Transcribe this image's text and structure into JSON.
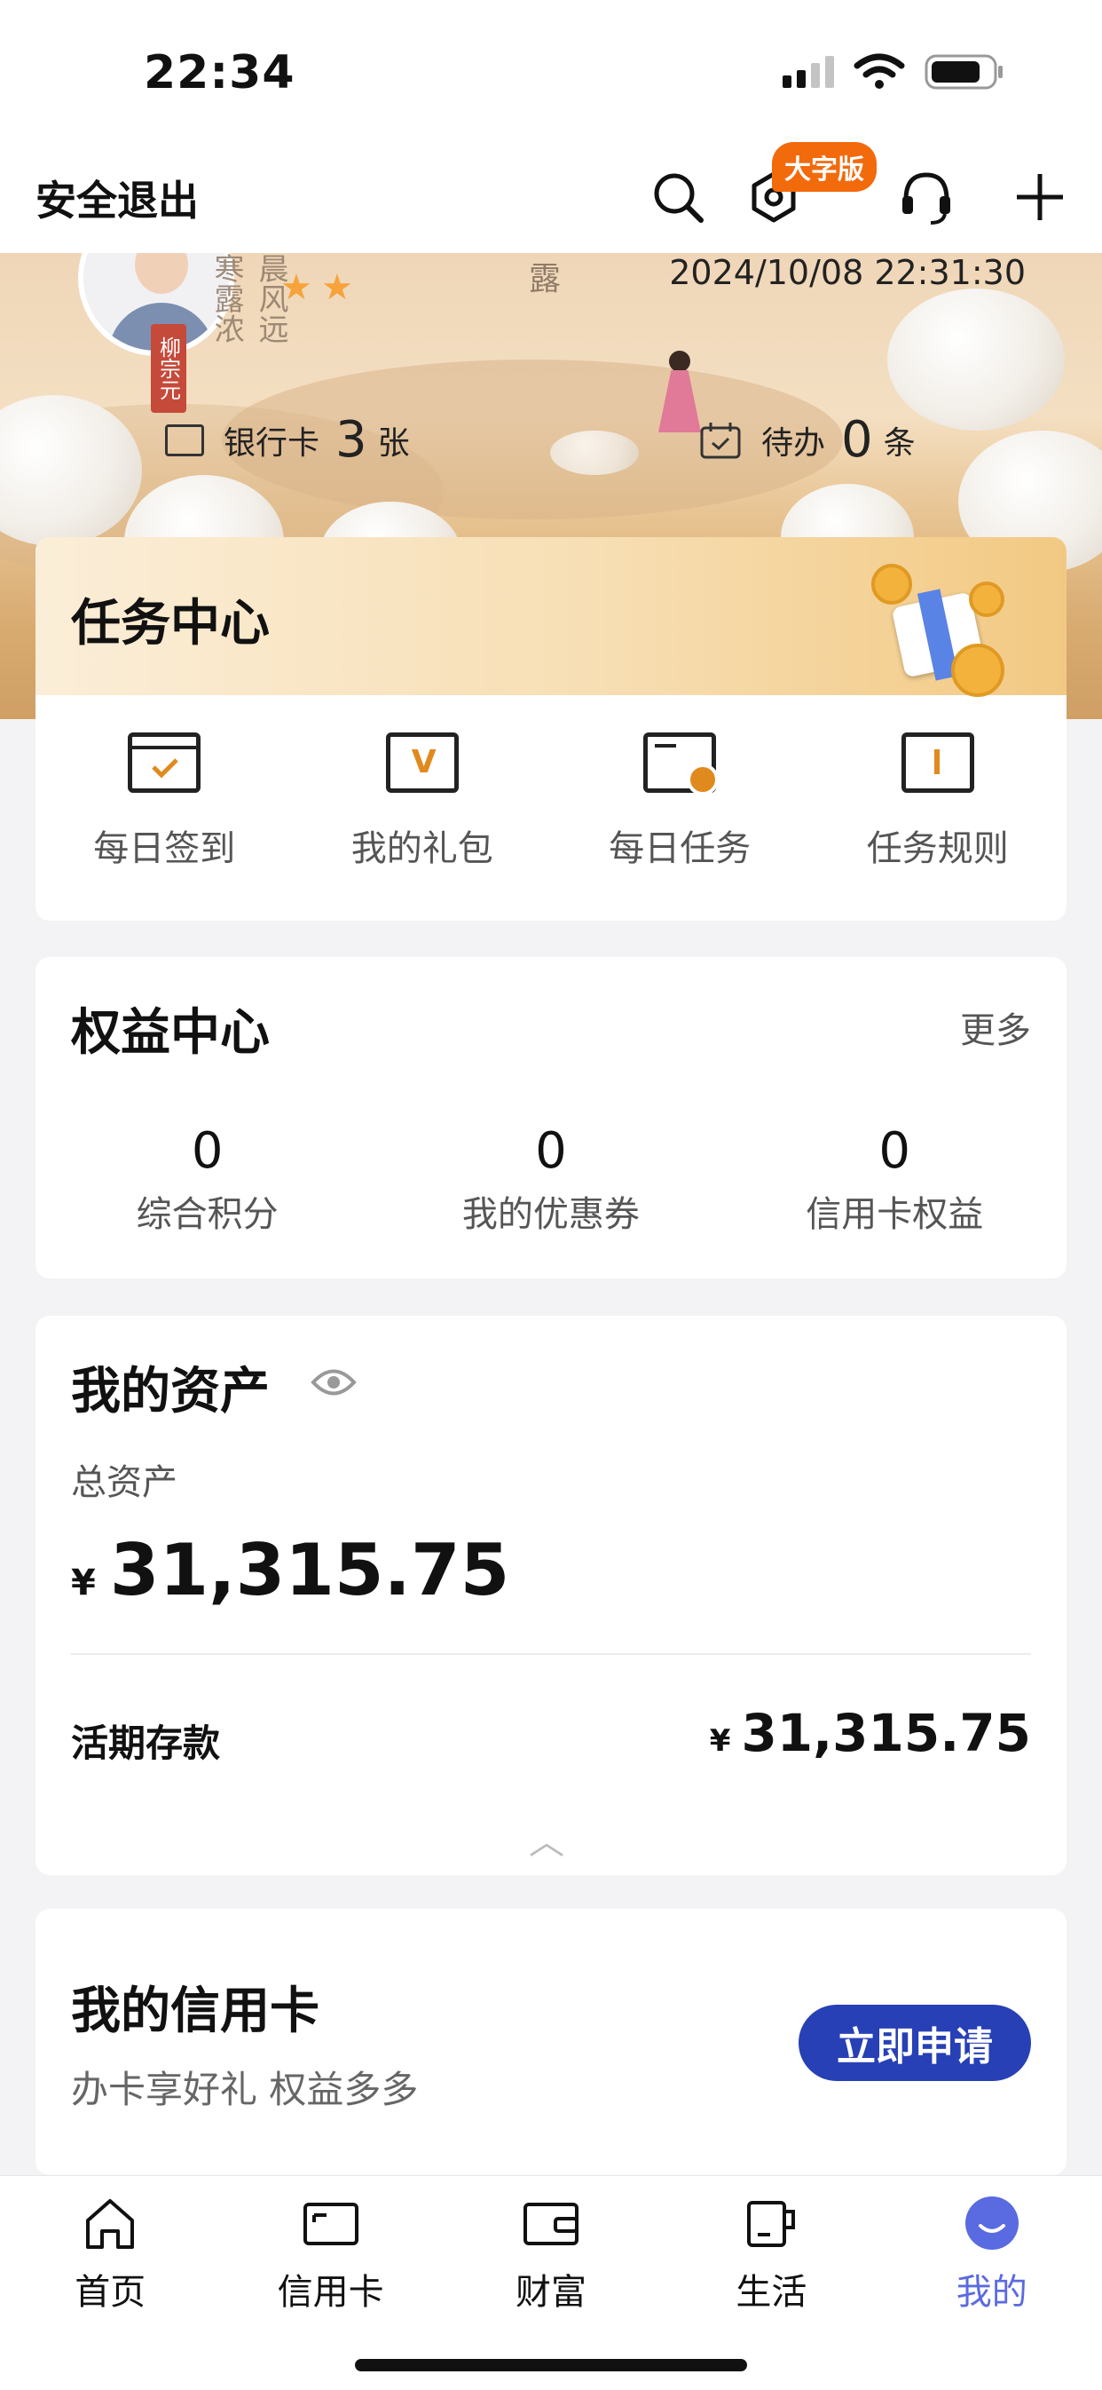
{
  "status_bar": {
    "time": "22:34"
  },
  "top_bar": {
    "exit_label": "安全退出",
    "big_font_badge": "大字版"
  },
  "banner": {
    "datetime": "2024/10/08 22:31:30",
    "poem_line1": "晨风",
    "poem_line2": "寒露浓",
    "poem_line3": "远",
    "poem_top": "露",
    "seal_text": "柳宗元",
    "bank_cards": {
      "label": "银行卡",
      "count": "3",
      "unit": "张"
    },
    "todo": {
      "label": "待办",
      "count": "0",
      "unit": "条"
    }
  },
  "task_center": {
    "title": "任务中心",
    "items": [
      {
        "label": "每日签到",
        "icon": "calendar-check-icon"
      },
      {
        "label": "我的礼包",
        "icon": "gift-bag-icon"
      },
      {
        "label": "每日任务",
        "icon": "task-clock-icon"
      },
      {
        "label": "任务规则",
        "icon": "rule-book-icon"
      }
    ]
  },
  "rights_center": {
    "title": "权益中心",
    "more": "更多",
    "items": [
      {
        "value": "0",
        "label": "综合积分"
      },
      {
        "value": "0",
        "label": "我的优惠券"
      },
      {
        "value": "0",
        "label": "信用卡权益"
      }
    ]
  },
  "assets": {
    "title": "我的资产",
    "total_label": "总资产",
    "currency": "¥",
    "total_value": "31,315.75",
    "demand_label": "活期存款",
    "demand_value": "31,315.75",
    "collapse_glyph": "︿"
  },
  "credit_card": {
    "title": "我的信用卡",
    "subtitle": "办卡享好礼 权益多多",
    "apply_label": "立即申请"
  },
  "tab_bar": {
    "tabs": [
      {
        "label": "首页",
        "icon": "home-icon"
      },
      {
        "label": "信用卡",
        "icon": "card-icon"
      },
      {
        "label": "财富",
        "icon": "wallet-icon"
      },
      {
        "label": "生活",
        "icon": "cup-icon"
      },
      {
        "label": "我的",
        "icon": "profile-icon",
        "active": true
      }
    ]
  },
  "colors": {
    "accent": "#2740b5",
    "active_tab": "#5a6ae0",
    "badge": "#f26a0c",
    "task_icon_accent": "#e08a1e"
  }
}
